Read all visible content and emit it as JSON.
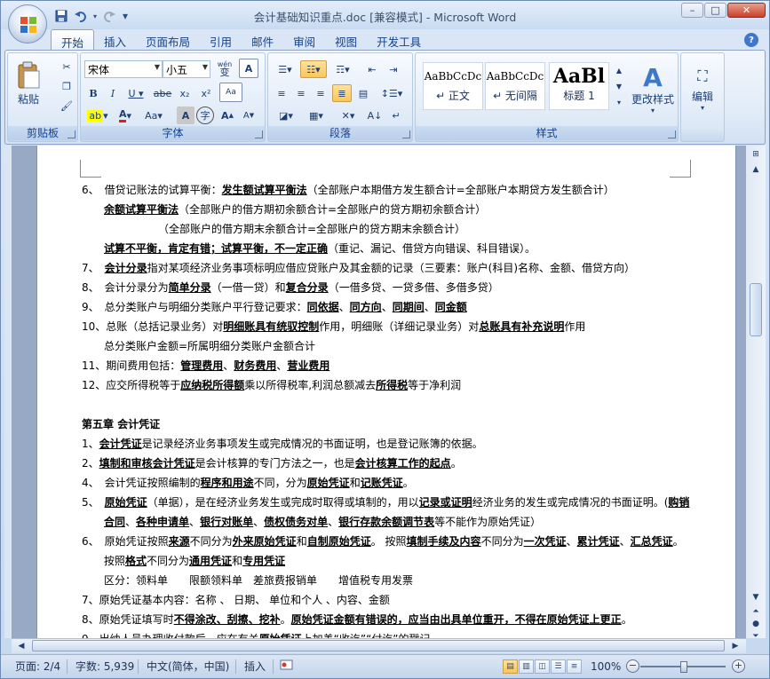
{
  "window": {
    "title": "会计基础知识重点.doc [兼容模式] - Microsoft Word",
    "minimize": "–",
    "maximize": "□",
    "close": "✕"
  },
  "qat": {
    "save_icon": "save-icon",
    "undo_icon": "undo-icon",
    "redo_icon": "redo-icon",
    "customize": "▾"
  },
  "tabs": [
    {
      "label": "开始",
      "active": true
    },
    {
      "label": "插入"
    },
    {
      "label": "页面布局"
    },
    {
      "label": "引用"
    },
    {
      "label": "邮件"
    },
    {
      "label": "审阅"
    },
    {
      "label": "视图"
    },
    {
      "label": "开发工具"
    }
  ],
  "ribbon": {
    "clipboard": {
      "label": "剪贴板",
      "paste": "粘贴"
    },
    "font": {
      "label": "字体",
      "font_name": "宋体",
      "font_size": "小五",
      "wen": "wén",
      "A": "A"
    },
    "paragraph": {
      "label": "段落"
    },
    "styles": {
      "label": "样式",
      "items": [
        {
          "preview": "AaBbCcDc",
          "name": "↵ 正文"
        },
        {
          "preview": "AaBbCcDc",
          "name": "↵ 无间隔"
        },
        {
          "preview": "AaBl",
          "name": "标题 1"
        }
      ],
      "change_styles": "更改样式"
    },
    "editing": {
      "label": "编辑"
    }
  },
  "document": {
    "lines": [
      {
        "html": "6、　借贷记账法的试算平衡：<b><u>发生额试算平衡法</u></b>（全部账户本期借方发生额合计=全部账户本期贷方发生额合计）"
      },
      {
        "html": "<b><u>余额试算平衡法</u></b>（全部账户的借方期初余额合计=全部账户的贷方期初余额合计）"
      },
      {
        "html": "（全部账户的借方期末余额合计=全部账户的贷方期末余额合计）"
      },
      {
        "html": "<b><u>试算不平衡，肯定有错；试算平衡，不一定正确</u></b>（重记、漏记、借贷方向错误、科目错误）。"
      },
      {
        "html": "7、　<b><u>会计分录</u></b>指对某项经济业务事项标明应借应贷账户及其金额的记录（三要素：账户(科目)名称、金额、借贷方向）"
      },
      {
        "html": "8、　会计分录分为<b><u>简单分录</u></b>（一借一贷）和<b><u>复合分录</u></b>（一借多贷、一贷多借、多借多贷）"
      },
      {
        "html": "9、　总分类账户与明细分类账户平行登记要求：<b><u>同依据</u></b>、<b><u>同方向</u></b>、<b><u>同期间</u></b>、<b><u>同金额</u></b>"
      },
      {
        "html": "10、总账（总括记录业务）对<b><u>明细账具有统驭控制</u></b>作用，明细账（详细记录业务）对<b><u>总账具有补充说明</u></b>作用"
      },
      {
        "html": "总分类账户金额=所属明细分类账户金额合计"
      },
      {
        "html": "11、期间费用包括：<b><u>管理费用</u></b>、<b><u>财务费用</u></b>、<b><u>营业费用</u></b>"
      },
      {
        "html": "12、应交所得税等于<b><u>应纳税所得额</u></b>乘以所得税率,利润总额减去<b><u>所得税</u></b>等于净利润"
      },
      {
        "html": ""
      },
      {
        "html": "<b>第五章 会计凭证</b>"
      },
      {
        "html": "1、<b><u>会计凭证</u></b>是记录经济业务事项发生或完成情况的书面证明，也是登记账簿的依据。"
      },
      {
        "html": "2、<b><u>填制和审核会计凭证</u></b>是会计核算的专门方法之一，也是<b><u>会计核算工作的起点</u></b>。"
      },
      {
        "html": "4、　会计凭证按照编制的<b><u>程序和用途</u></b>不同，分为<b><u>原始凭证</u></b>和<b><u>记账凭证</u></b>。"
      },
      {
        "html": "5、　<b><u>原始凭证</u></b>（单据），是在经济业务发生或完成时取得或填制的，用以<b><u>记录或证明</u></b>经济业务的发生或完成情况的书面证明。(<b><u>购销</u></b>"
      },
      {
        "html": "<b><u>合同</u></b>、<b><u>各种申请单</u></b>、<b><u>银行对账单</u></b>、<b><u>债权债务对单</u></b>、<b><u>银行存款余额调节表</u></b>等不能作为原始凭证）"
      },
      {
        "html": "6、　原始凭证按照<b><u>来源</u></b>不同分为<b><u>外来原始凭证</u></b>和<b><u>自制原始凭证</u></b>。 按照<b><u>填制手续及内容</u></b>不同分为<b><u>一次凭证</u></b>、<b><u>累计凭证</u></b>、<b><u>汇总凭证</u></b>。"
      },
      {
        "html": "按照<b><u>格式</u></b>不同分为<b><u>通用凭证</u></b>和<b><u>专用凭证</u></b>"
      },
      {
        "html": "区分：领料单　　限额领料单　差旅费报销单　　增值税专用发票"
      },
      {
        "html": "7、原始凭证基本内容：名称 、 日期、 单位和个人 、内容、金额"
      },
      {
        "html": "8、原始凭证填写时<b><u>不得涂改、刮擦、挖补</u></b>。<b><u>原始凭证金额有错误的，应当由出具单位重开，不得在原始凭证上更正</u></b>。"
      },
      {
        "html": "9、出纳人员办理收付款后，应在有关<b><u>原始凭证</u></b>上加盖“收讫”“付讫”的戳记。"
      }
    ]
  },
  "status": {
    "page": "页面: 2/4",
    "words": "字数: 5,939",
    "language": "中文(简体，中国)",
    "mode": "插入",
    "zoom": "100%",
    "zoom_minus": "−",
    "zoom_plus": "+"
  }
}
